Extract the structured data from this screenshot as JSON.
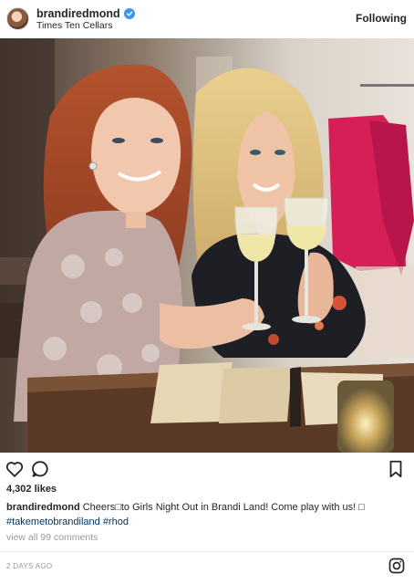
{
  "header": {
    "username": "brandiredmond",
    "location": "Times Ten Cellars",
    "follow_label": "Following",
    "verified_color": "#3897f0"
  },
  "post": {
    "likes": "4,302 likes",
    "caption_user": "brandiredmond",
    "caption_text": "Cheers□to Girls Night Out in Brandi Land! Come play with us! □",
    "hashtag_1": "#takemetobrandiland",
    "hashtag_2": "#rhod",
    "view_comments": "view all 99 comments",
    "timestamp": "2 DAYS AGO"
  },
  "icons": [
    "heart-icon",
    "comment-icon",
    "bookmark-icon",
    "instagram-icon",
    "verified-badge-icon"
  ],
  "colors": {
    "text": "#262626",
    "muted": "#999999",
    "hashtag": "#003569",
    "divider": "#efefef"
  }
}
